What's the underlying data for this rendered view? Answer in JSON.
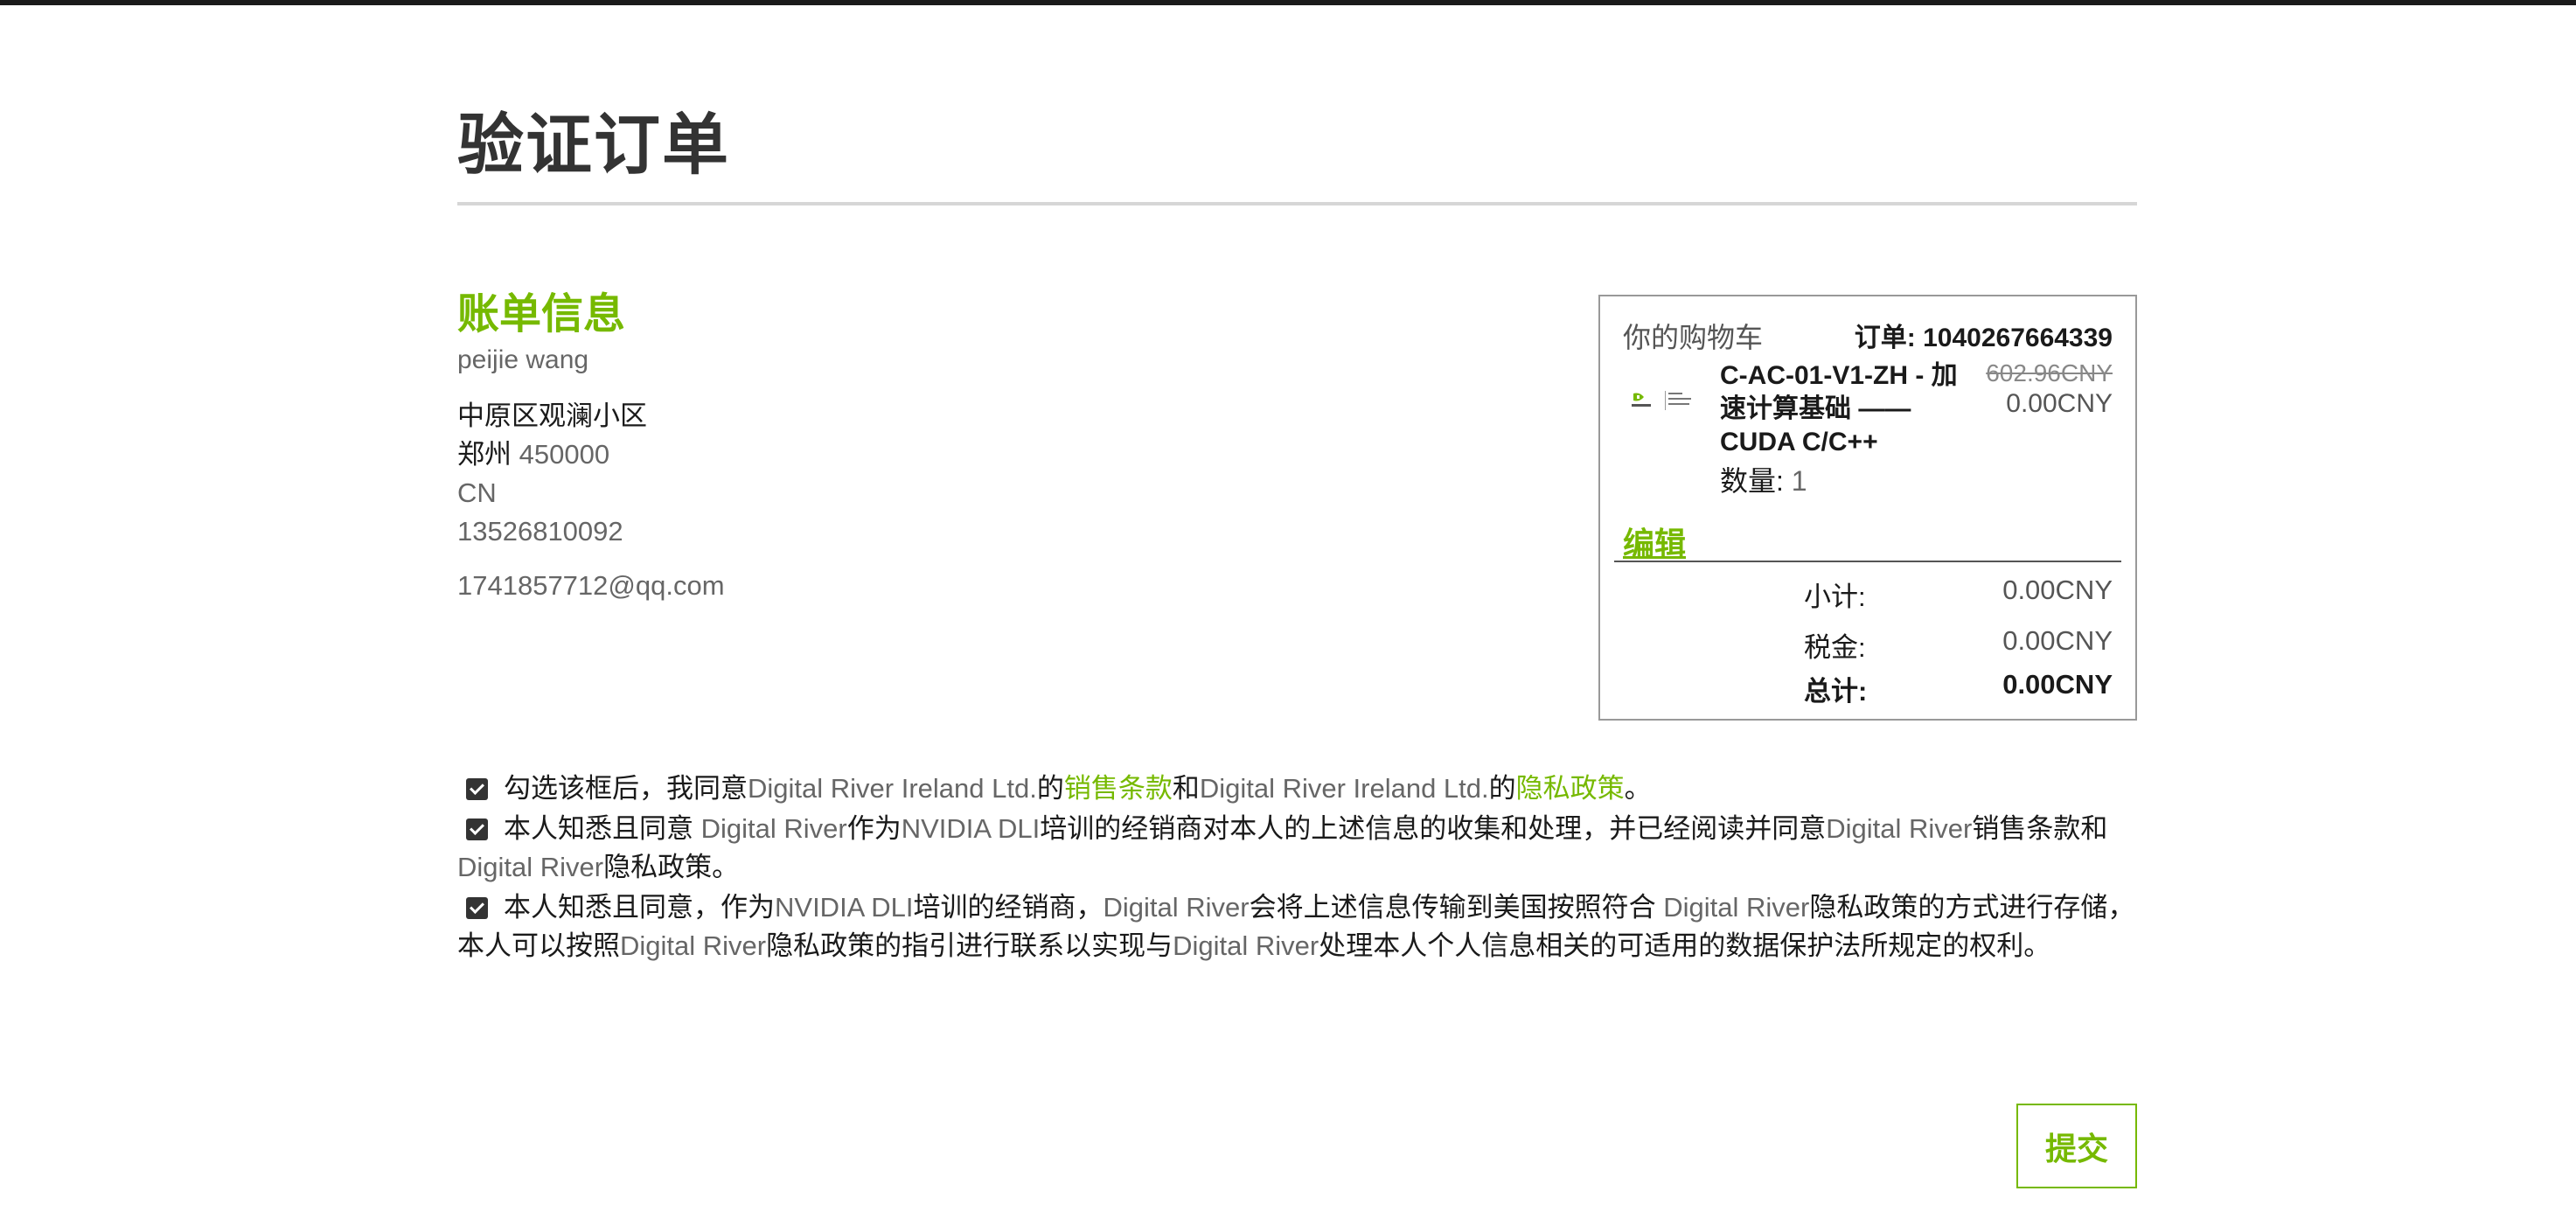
{
  "page_title": "验证订单",
  "billing": {
    "heading": "账单信息",
    "name": "peijie wang",
    "address_line": "中原区观澜小区",
    "city": "郑州",
    "postal_code": "450000",
    "country": "CN",
    "phone": "13526810092",
    "email": "1741857712@qq.com"
  },
  "cart": {
    "title": "你的购物车",
    "order_number": "订单: 1040267664339",
    "product_logo": "nvidia-deep-learning-institute-logo",
    "product_name": "C-AC-01-V1-ZH - 加速计算基础 —— CUDA C/C++",
    "price_original": "602.96CNY",
    "price_current": "0.00CNY",
    "quantity_label": "数量:",
    "quantity_value": "1",
    "edit_label": "编辑",
    "subtotal_label": "小计:",
    "subtotal_value": "0.00CNY",
    "tax_label": "税金:",
    "tax_value": "0.00CNY",
    "total_label": "总计:",
    "total_value": "0.00CNY"
  },
  "terms": {
    "t1_a": "勾选该框后，我同意",
    "t1_dr1": "Digital River Ireland Ltd.",
    "t1_b": "的",
    "t1_link1": "销售条款",
    "t1_c": "和",
    "t1_dr2": "Digital River Ireland Ltd.",
    "t1_d": "的",
    "t1_link2": "隐私政策",
    "t1_e": "。",
    "t2_a": "本人知悉且同意 ",
    "t2_dr1": "Digital River",
    "t2_b": "作为",
    "t2_nv": "NVIDIA DLI",
    "t2_c": "培训的经销商对本人的上述信息的收集和处理，并已经阅读并同意",
    "t2_dr2": "Digital River",
    "t2_d": "销售条款和",
    "t2_dr3": "Digital River",
    "t2_e": "隐私政策。",
    "t3_a": "本人知悉且同意，作为",
    "t3_nv": "NVIDIA DLI",
    "t3_b": "培训的经销商，",
    "t3_dr1": "Digital River",
    "t3_c": "会将上述信息传输到美国按照符合 ",
    "t3_dr2": "Digital River",
    "t3_d": "隐私政策的方式进行存储，本人可以按照",
    "t3_dr3": "Digital River",
    "t3_e": "隐私政策的指引进行联系以实现与",
    "t3_dr4": "Digital River",
    "t3_f": "处理本人个人信息相关的可适用的数据保护法所规定的权利。"
  },
  "submit_label": "提交",
  "colors": {
    "accent_green": "#76b900",
    "text_dark": "#1a1a1a",
    "text_gray": "#666666",
    "border_gray": "#999999"
  }
}
